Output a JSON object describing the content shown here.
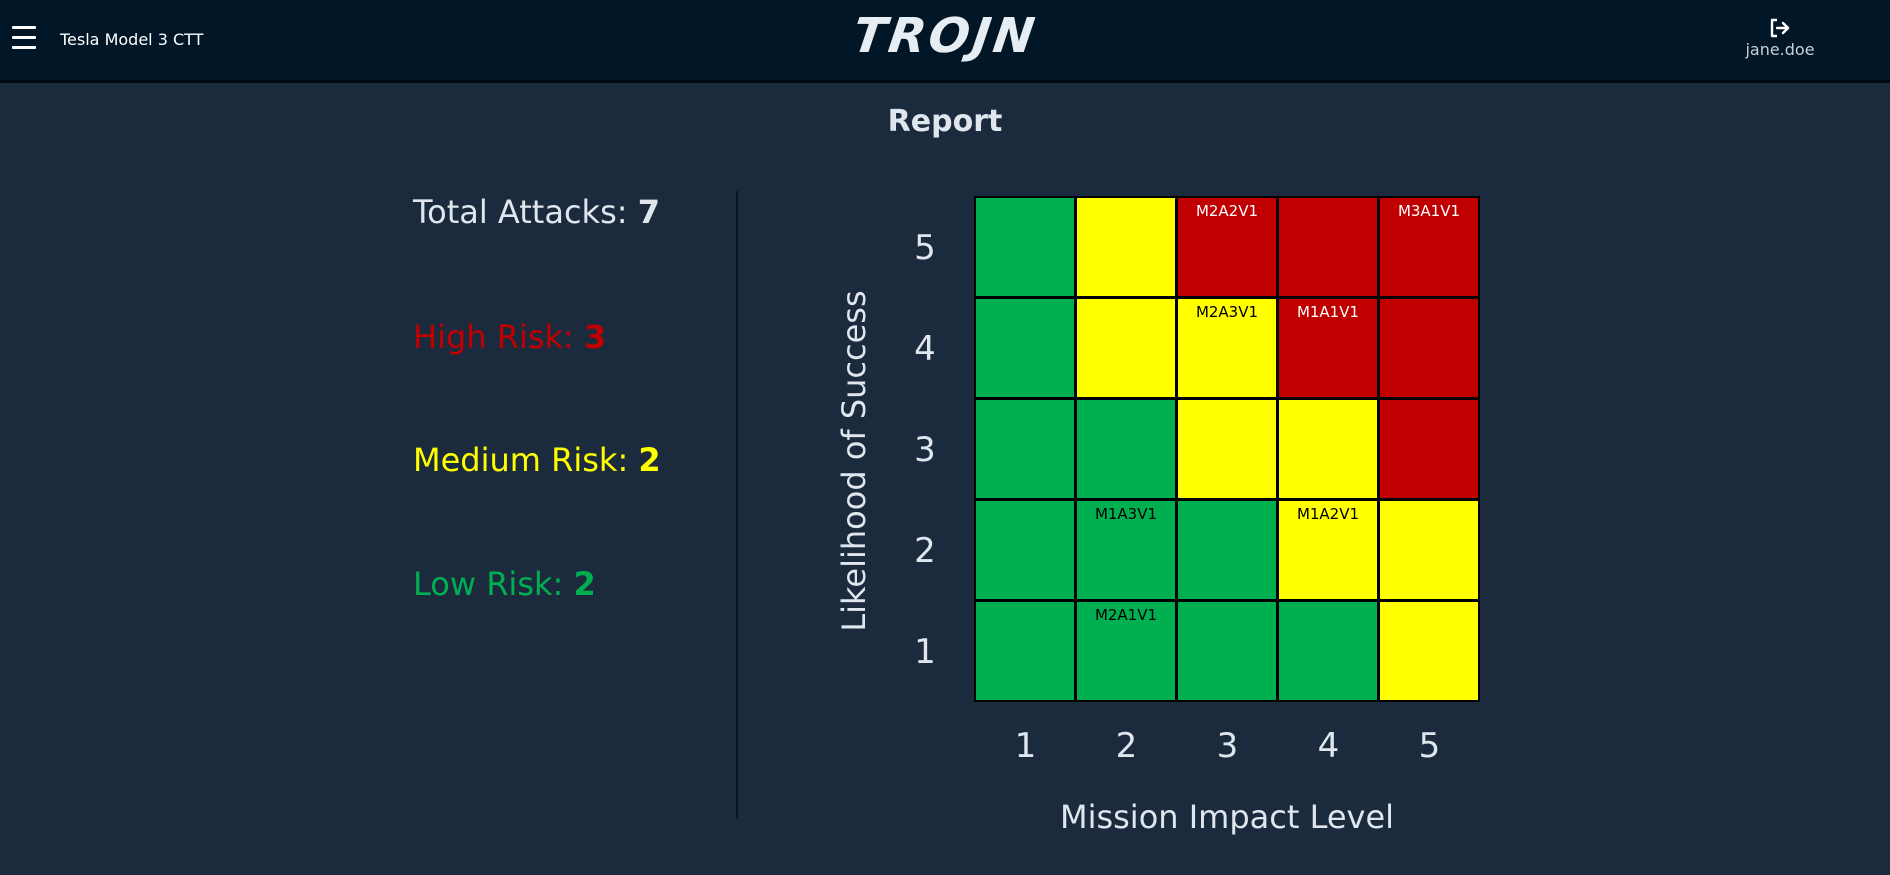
{
  "header": {
    "project_name": "Tesla Model 3 CTT",
    "logo_text": "TROJN",
    "username": "jane.doe",
    "logout_icon": "logout-icon",
    "menu_icon": "hamburger-menu-icon"
  },
  "page": {
    "title": "Report"
  },
  "stats": {
    "total_label": "Total Attacks:",
    "total_value": "7",
    "high_label": "High Risk:",
    "high_value": "3",
    "medium_label": "Medium Risk:",
    "medium_value": "2",
    "low_label": "Low Risk:",
    "low_value": "2"
  },
  "colors": {
    "high": "#c00000",
    "medium": "#ffff00",
    "low": "#00b050",
    "background": "#1c2a3e",
    "header": "#011627"
  },
  "chart_data": {
    "type": "heatmap",
    "xlabel": "Mission Impact Level",
    "ylabel": "Likelihood of Success",
    "x_ticks": [
      "1",
      "2",
      "3",
      "4",
      "5"
    ],
    "y_ticks": [
      "5",
      "4",
      "3",
      "2",
      "1"
    ],
    "risk_grid": [
      [
        "low",
        "medium",
        "high",
        "high",
        "high"
      ],
      [
        "low",
        "medium",
        "medium",
        "high",
        "high"
      ],
      [
        "low",
        "low",
        "medium",
        "medium",
        "high"
      ],
      [
        "low",
        "low",
        "low",
        "medium",
        "medium"
      ],
      [
        "low",
        "low",
        "low",
        "low",
        "medium"
      ]
    ],
    "cell_labels": [
      [
        "",
        "",
        "M2A2V1",
        "",
        "M3A1V1"
      ],
      [
        "",
        "",
        "M2A3V1",
        "M1A1V1",
        ""
      ],
      [
        "",
        "",
        "",
        "",
        ""
      ],
      [
        "",
        "M1A3V1",
        "",
        "M1A2V1",
        ""
      ],
      [
        "",
        "M2A1V1",
        "",
        "",
        ""
      ]
    ]
  }
}
